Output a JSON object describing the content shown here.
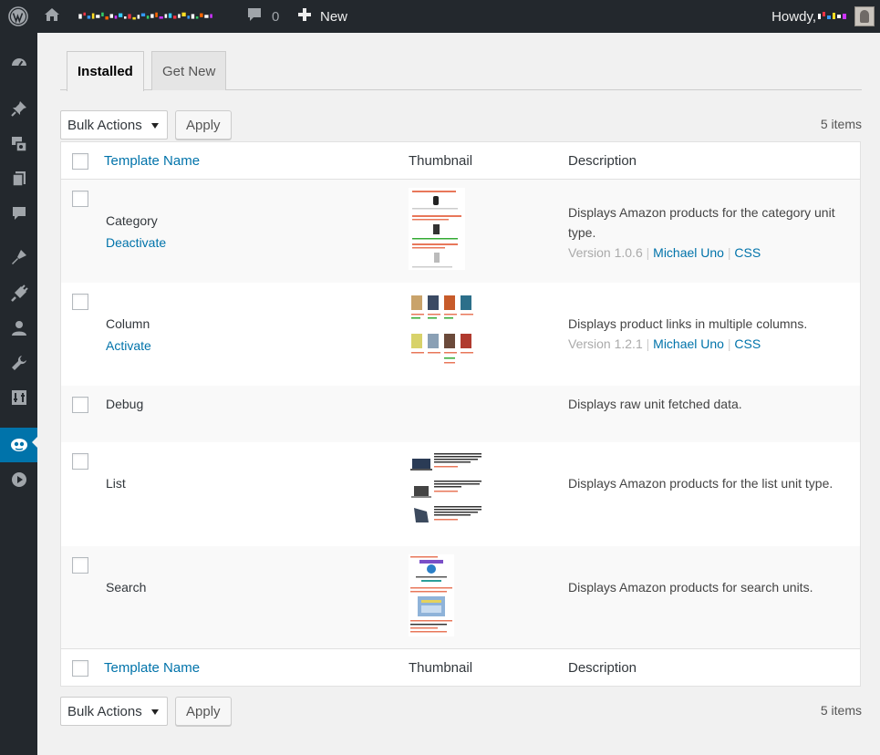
{
  "adminbar": {
    "comments_count": "0",
    "new_label": "New",
    "howdy_label": "Howdy,"
  },
  "tabs": [
    {
      "label": "Installed"
    },
    {
      "label": "Get New"
    }
  ],
  "bulk": {
    "select_value": "Bulk Actions",
    "apply_label": "Apply",
    "count_label": "5 items"
  },
  "table": {
    "columns": {
      "name": "Template Name",
      "thumbnail": "Thumbnail",
      "description": "Description"
    },
    "rows": [
      {
        "name": "Category",
        "action": "Deactivate",
        "description": "Displays Amazon products for the category unit type.",
        "version": "Version 1.0.6",
        "author": "Michael Uno",
        "css": "CSS"
      },
      {
        "name": "Column",
        "action": "Activate",
        "description": "Displays product links in multiple columns.",
        "version": "Version 1.2.1",
        "author": "Michael Uno",
        "css": "CSS"
      },
      {
        "name": "Debug",
        "description": "Displays raw unit fetched data."
      },
      {
        "name": "List",
        "description": "Displays Amazon products for the list unit type."
      },
      {
        "name": "Search",
        "description": "Displays Amazon products for search units."
      }
    ]
  },
  "colors": {
    "adminbar_bg": "#23282d",
    "link": "#0073aa",
    "active_menu": "#0073aa",
    "page_bg": "#f1f1f1"
  }
}
